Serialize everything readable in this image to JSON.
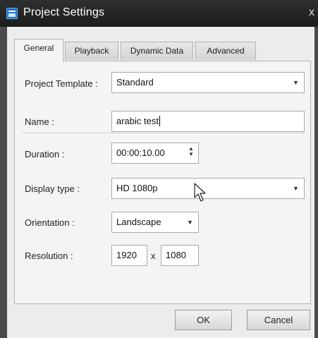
{
  "window": {
    "title": "Project Settings",
    "close_label": "x"
  },
  "tabs": [
    {
      "label": "General",
      "active": true
    },
    {
      "label": "Playback",
      "active": false
    },
    {
      "label": "Dynamic Data",
      "active": false
    },
    {
      "label": "Advanced",
      "active": false
    }
  ],
  "form": {
    "project_template": {
      "label": "Project Template :",
      "value": "Standard"
    },
    "name": {
      "label": "Name :",
      "value": "arabic test"
    },
    "duration": {
      "label": "Duration :",
      "value": "00:00:10.00"
    },
    "display_type": {
      "label": "Display type :",
      "value": "HD 1080p"
    },
    "orientation": {
      "label": "Orientation :",
      "value": "Landscape"
    },
    "resolution": {
      "label": "Resolution :",
      "width": "1920",
      "separator": "x",
      "height": "1080"
    }
  },
  "buttons": {
    "ok": "OK",
    "cancel": "Cancel"
  },
  "icons": {
    "dropdown": "chevron-down-icon",
    "spinner": "spinner-arrows-icon",
    "cursor": "mouse-pointer-icon",
    "app": "project-settings-icon"
  }
}
